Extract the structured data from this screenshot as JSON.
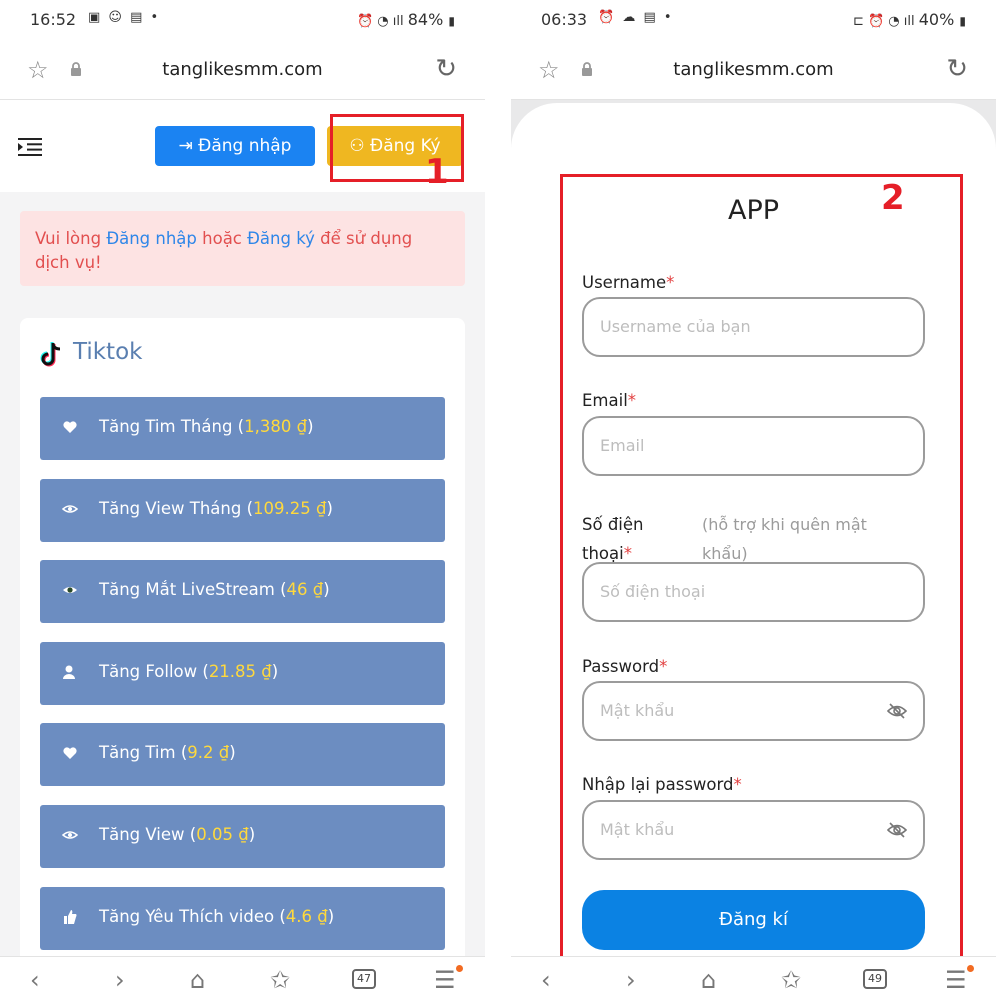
{
  "left": {
    "status": {
      "time": "16:52",
      "battery": "84%"
    },
    "url": "tanglikesmm.com",
    "nav": {
      "login_label": "Đăng nhập",
      "register_label": "Đăng Ký"
    },
    "annotation_number": "1",
    "alert": {
      "part1": "Vui lòng ",
      "login_link": "Đăng nhập",
      "part2": " hoặc ",
      "register_link": "Đăng ký",
      "part3": " để sử dụng dịch vụ!"
    },
    "card_title": "Tiktok",
    "services": [
      {
        "label": "Tăng Tim Tháng (",
        "price": "1,380 ₫",
        "close": ")",
        "icon": "heart-icon"
      },
      {
        "label": "Tăng View Tháng (",
        "price": "109.25 ₫",
        "close": ")",
        "icon": "eye-icon"
      },
      {
        "label": "Tăng Mắt LiveStream (",
        "price": "46 ₫",
        "close": ")",
        "icon": "eye-filled-icon"
      },
      {
        "label": "Tăng Follow (",
        "price": "21.85 ₫",
        "close": ")",
        "icon": "user-icon"
      },
      {
        "label": "Tăng Tim (",
        "price": "9.2 ₫",
        "close": ")",
        "icon": "heart-icon"
      },
      {
        "label": "Tăng View (",
        "price": "0.05 ₫",
        "close": ")",
        "icon": "eye-icon"
      },
      {
        "label": "Tăng Yêu Thích video (",
        "price": "4.6 ₫",
        "close": ")",
        "icon": "thumbs-up-icon"
      }
    ],
    "tab_count": "47"
  },
  "right": {
    "status": {
      "time": "06:33",
      "battery": "40%"
    },
    "url": "tanglikesmm.com",
    "annotation_number": "2",
    "app_title": "APP",
    "fields": {
      "username": {
        "label": "Username",
        "placeholder": "Username của bạn"
      },
      "email": {
        "label": "Email",
        "placeholder": "Email"
      },
      "phone": {
        "label_line1": "Số điện",
        "label_line2": "thoại",
        "hint": "(hỗ trợ khi quên mật khẩu)",
        "placeholder": "Số điện thoại"
      },
      "password": {
        "label": "Password",
        "placeholder": "Mật khẩu"
      },
      "confirm": {
        "label": "Nhập lại password",
        "placeholder": "Mật khẩu"
      }
    },
    "required_mark": "*",
    "submit_label": "Đăng kí",
    "tab_count": "49"
  },
  "colors": {
    "primary_blue": "#1b83f2",
    "register_yellow": "#efb721",
    "service_blue": "#6c8dc1",
    "price_yellow": "#ffd93d",
    "annotation_red": "#e51f28"
  }
}
